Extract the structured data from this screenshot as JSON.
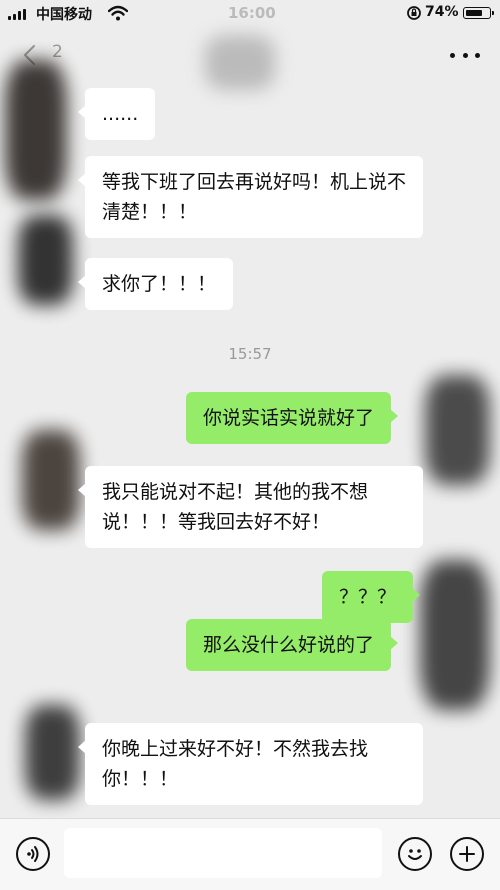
{
  "status_bar": {
    "carrier": "中国移动",
    "time": "16:00",
    "battery_percent": "74%",
    "battery_level": 0.74
  },
  "nav": {
    "title": "2"
  },
  "messages": [
    {
      "side": "left",
      "text": "......"
    },
    {
      "side": "left",
      "text": "等我下班了回去再说好吗！机上说不清楚！！！"
    },
    {
      "side": "left",
      "text": "求你了！！！"
    },
    {
      "side": "right",
      "text": "你说实话实说就好了"
    },
    {
      "side": "left",
      "text": "我只能说对不起！其他的我不想说！！！等我回去好不好！"
    },
    {
      "side": "right",
      "text": "？？？"
    },
    {
      "side": "right",
      "text": "那么没什么好说的了"
    },
    {
      "side": "left",
      "text": "你晚上过来好不好！不然我去找你！！！"
    }
  ],
  "timestamp": "15:57",
  "input_bar": {
    "placeholder": "",
    "icons": [
      "voice-icon",
      "emoji-icon",
      "plus-icon"
    ]
  },
  "colors": {
    "background": "#ededed",
    "bubble_sent": "#95ec69",
    "bubble_received": "#ffffff"
  }
}
